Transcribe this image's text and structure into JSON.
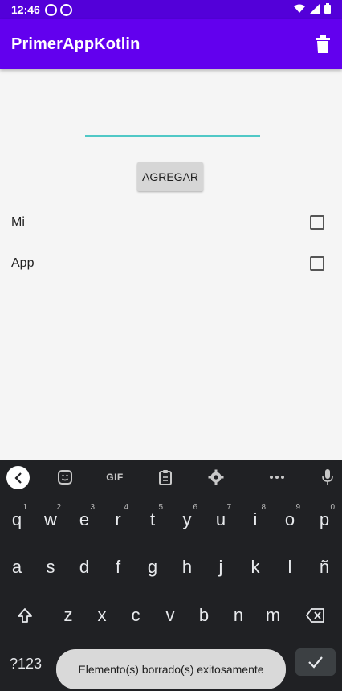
{
  "status_bar": {
    "time": "12:46"
  },
  "app_bar": {
    "title": "PrimerAppKotlin"
  },
  "form": {
    "input_value": "",
    "add_button_label": "AGREGAR"
  },
  "list": [
    {
      "label": "Mi",
      "checked": false
    },
    {
      "label": "App",
      "checked": false
    }
  ],
  "keyboard": {
    "toolbar": {
      "gif_label": "GIF"
    },
    "row1": [
      {
        "key": "q",
        "sup": "1"
      },
      {
        "key": "w",
        "sup": "2"
      },
      {
        "key": "e",
        "sup": "3"
      },
      {
        "key": "r",
        "sup": "4"
      },
      {
        "key": "t",
        "sup": "5"
      },
      {
        "key": "y",
        "sup": "6"
      },
      {
        "key": "u",
        "sup": "7"
      },
      {
        "key": "i",
        "sup": "8"
      },
      {
        "key": "o",
        "sup": "9"
      },
      {
        "key": "p",
        "sup": "0"
      }
    ],
    "row2": [
      "a",
      "s",
      "d",
      "f",
      "g",
      "h",
      "j",
      "k",
      "l",
      "ñ"
    ],
    "row3": [
      "z",
      "x",
      "c",
      "v",
      "b",
      "n",
      "m"
    ],
    "symbols_label": "?123"
  },
  "toast": {
    "message": "Elemento(s) borrado(s) exitosamente"
  },
  "colors": {
    "status_bar": "#5300d9",
    "app_bar": "#6200ee",
    "input_underline": "#50c8c6"
  }
}
